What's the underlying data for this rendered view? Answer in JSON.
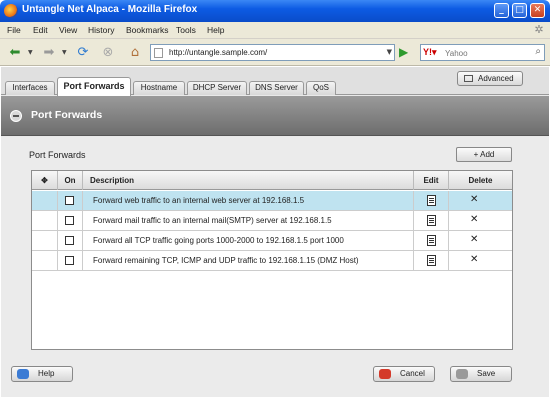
{
  "window": {
    "title": "Untangle Net Alpaca - Mozilla Firefox"
  },
  "menu": [
    "File",
    "Edit",
    "View",
    "History",
    "Bookmarks",
    "Tools",
    "Help"
  ],
  "browser": {
    "url": "http://untangle.sample.com/",
    "search_placeholder": "Yahoo"
  },
  "tabs": [
    "Interfaces",
    "Port Forwards",
    "Hostname",
    "DHCP Server",
    "DNS Server",
    "QoS"
  ],
  "advanced_label": "Advanced",
  "panel": {
    "title": "Port Forwards"
  },
  "section": {
    "title": "Port Forwards",
    "add_label": "+ Add"
  },
  "grid": {
    "headers": {
      "on": "On",
      "description": "Description",
      "edit": "Edit",
      "delete": "Delete"
    },
    "rows": [
      {
        "description": "Forward web traffic to an internal web server at 192.168.1.5",
        "enabled": false,
        "selected": true
      },
      {
        "description": "Forward mail traffic to an internal mail(SMTP) server at 192.168.1.5",
        "enabled": false,
        "selected": false
      },
      {
        "description": "Forward all TCP traffic going  ports 1000-2000 to 192.168.1.5 port 1000",
        "enabled": false,
        "selected": false
      },
      {
        "description": "Forward remaining TCP, ICMP and UDP traffic to 192.168.1.15 (DMZ Host)",
        "enabled": false,
        "selected": false
      }
    ],
    "delete_glyph": "✕"
  },
  "footer": {
    "help": "Help",
    "cancel": "Cancel",
    "save": "Save"
  },
  "colors": {
    "title_blue": "#0d5be3",
    "selected_row": "#bfe3f0",
    "panel_header": "#7d7d7d"
  }
}
